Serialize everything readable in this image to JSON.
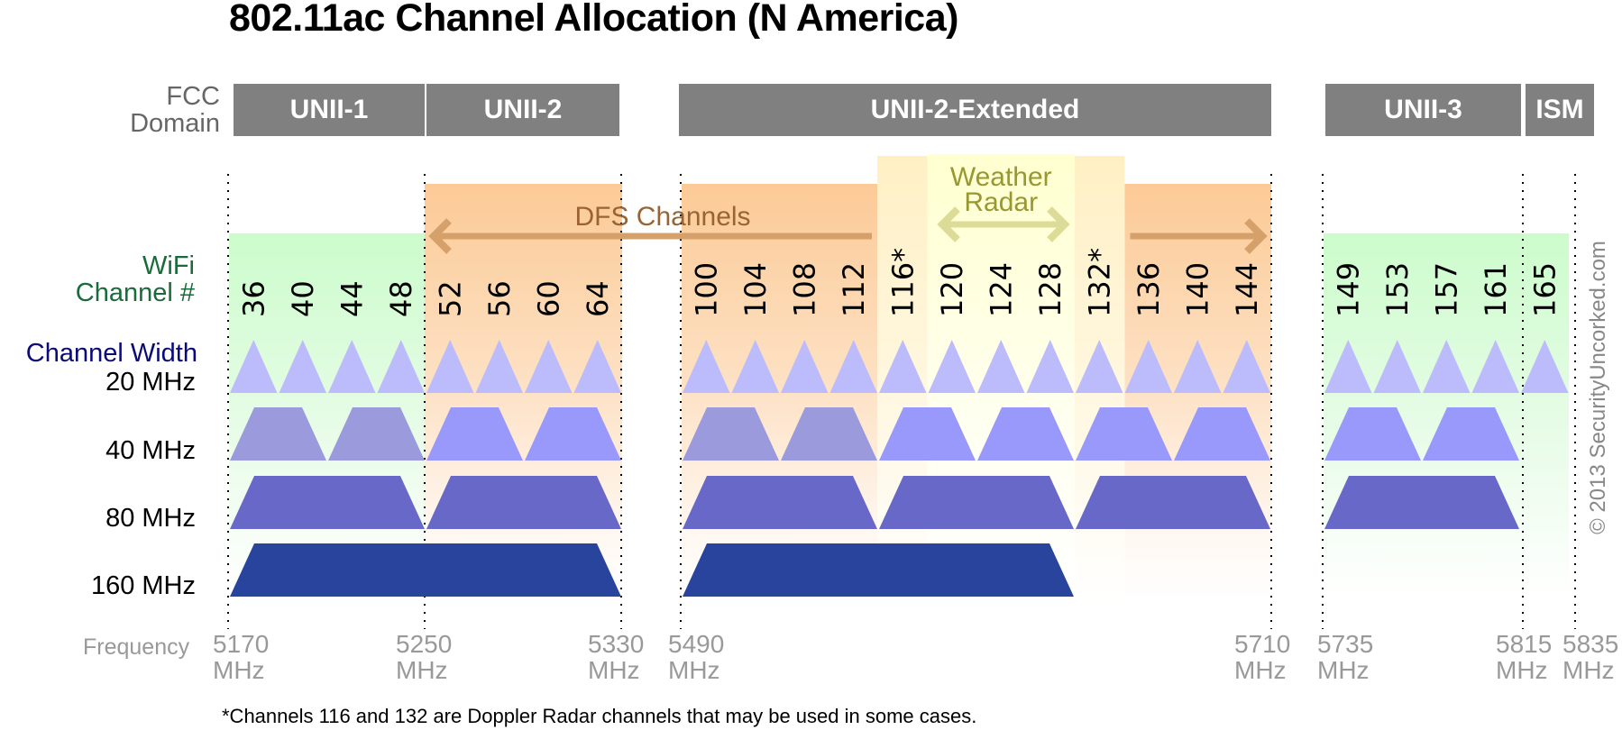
{
  "title": "802.11ac Channel Allocation (N America)",
  "labels": {
    "fcc_line1": "FCC",
    "fcc_line2": "Domain",
    "wifi_line1": "WiFi",
    "wifi_line2": "Channel #",
    "channel_width": "Channel Width",
    "w20": "20 MHz",
    "w40": "40 MHz",
    "w80": "80 MHz",
    "w160": "160 MHz",
    "frequency": "Frequency",
    "dfs": "DFS Channels",
    "weather_line1": "Weather",
    "weather_line2": "Radar"
  },
  "fcc_domains": [
    {
      "name": "UNII-1",
      "from_mhz": 5170,
      "to_mhz": 5250
    },
    {
      "name": "UNII-2",
      "from_mhz": 5250,
      "to_mhz": 5330
    },
    {
      "name": "UNII-2-Extended",
      "from_mhz": 5490,
      "to_mhz": 5710
    },
    {
      "name": "UNII-3",
      "from_mhz": 5735,
      "to_mhz": 5815
    },
    {
      "name": "ISM",
      "from_mhz": 5815,
      "to_mhz": 5835
    }
  ],
  "frequency_ticks": [
    {
      "value": "5170",
      "unit": "MHz"
    },
    {
      "value": "5250",
      "unit": "MHz"
    },
    {
      "value": "5330",
      "unit": "MHz"
    },
    {
      "value": "5490",
      "unit": "MHz"
    },
    {
      "value": "5710",
      "unit": "MHz"
    },
    {
      "value": "5735",
      "unit": "MHz"
    },
    {
      "value": "5815",
      "unit": "MHz"
    },
    {
      "value": "5835",
      "unit": "MHz"
    }
  ],
  "channels": [
    {
      "num": "36",
      "group": "unii1"
    },
    {
      "num": "40",
      "group": "unii1"
    },
    {
      "num": "44",
      "group": "unii1"
    },
    {
      "num": "48",
      "group": "unii1"
    },
    {
      "num": "52",
      "group": "dfs"
    },
    {
      "num": "56",
      "group": "dfs"
    },
    {
      "num": "60",
      "group": "dfs"
    },
    {
      "num": "64",
      "group": "dfs"
    },
    {
      "num": "100",
      "group": "dfs"
    },
    {
      "num": "104",
      "group": "dfs"
    },
    {
      "num": "108",
      "group": "dfs"
    },
    {
      "num": "112",
      "group": "dfs"
    },
    {
      "num": "116*",
      "group": "doppler"
    },
    {
      "num": "120",
      "group": "weather"
    },
    {
      "num": "124",
      "group": "weather"
    },
    {
      "num": "128",
      "group": "weather"
    },
    {
      "num": "132*",
      "group": "doppler"
    },
    {
      "num": "136",
      "group": "dfs"
    },
    {
      "num": "140",
      "group": "dfs"
    },
    {
      "num": "144",
      "group": "dfs"
    },
    {
      "num": "149",
      "group": "unii3"
    },
    {
      "num": "153",
      "group": "unii3"
    },
    {
      "num": "157",
      "group": "unii3"
    },
    {
      "num": "161",
      "group": "unii3"
    },
    {
      "num": "165",
      "group": "ism"
    }
  ],
  "chart_data": {
    "type": "table",
    "title": "802.11ac Channel Allocation (N America)",
    "widths_mhz": [
      20,
      40,
      80,
      160
    ],
    "blocks": {
      "20": [
        [
          "36"
        ],
        [
          "40"
        ],
        [
          "44"
        ],
        [
          "48"
        ],
        [
          "52"
        ],
        [
          "56"
        ],
        [
          "60"
        ],
        [
          "64"
        ],
        [
          "100"
        ],
        [
          "104"
        ],
        [
          "108"
        ],
        [
          "112"
        ],
        [
          "116"
        ],
        [
          "120"
        ],
        [
          "124"
        ],
        [
          "128"
        ],
        [
          "132"
        ],
        [
          "136"
        ],
        [
          "140"
        ],
        [
          "144"
        ],
        [
          "149"
        ],
        [
          "153"
        ],
        [
          "157"
        ],
        [
          "161"
        ],
        [
          "165"
        ]
      ],
      "40": [
        [
          "36",
          "40"
        ],
        [
          "44",
          "48"
        ],
        [
          "52",
          "56"
        ],
        [
          "60",
          "64"
        ],
        [
          "100",
          "104"
        ],
        [
          "108",
          "112"
        ],
        [
          "116",
          "120"
        ],
        [
          "124",
          "128"
        ],
        [
          "132",
          "136"
        ],
        [
          "140",
          "144"
        ],
        [
          "149",
          "153"
        ],
        [
          "157",
          "161"
        ]
      ],
      "80": [
        [
          "36",
          "48"
        ],
        [
          "52",
          "64"
        ],
        [
          "100",
          "112"
        ],
        [
          "116",
          "128"
        ],
        [
          "132",
          "144"
        ],
        [
          "149",
          "161"
        ]
      ],
      "160": [
        [
          "36",
          "64"
        ],
        [
          "100",
          "128"
        ]
      ]
    },
    "dimmed_40mhz_blocks": [
      [
        "36",
        "40"
      ],
      [
        "44",
        "48"
      ],
      [
        "100",
        "104"
      ],
      [
        "108",
        "112"
      ]
    ],
    "dfs_range": [
      "52",
      "144"
    ],
    "weather_radar_range": [
      "120",
      "128"
    ],
    "doppler_channels": [
      "116",
      "132"
    ]
  },
  "colors": {
    "fcc_box": "#808080",
    "unii_green": "#ccffcc",
    "dfs_orange": "#fccc98",
    "weather_yellow": "#ffffd4",
    "doppler_yellow": "#fff2c8",
    "dfs_arrow": "#d6a06a",
    "weather_arrow": "#dcdc98",
    "w20": "#bcbcfc",
    "w40": "#9999fc",
    "w40_dim": "#9a9adc",
    "w80": "#6868c8",
    "w160": "#28449c"
  },
  "footnote": "*Channels 116 and 132 are Doppler Radar channels that may be used in some cases.",
  "copyright": "© 2013 SecurityUncorked.com"
}
